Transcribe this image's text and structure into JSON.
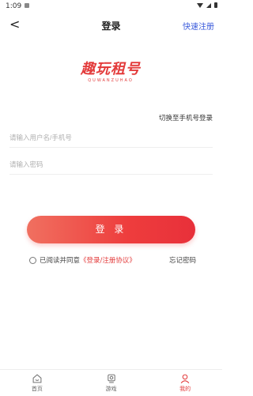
{
  "status": {
    "time": "1:09"
  },
  "header": {
    "back_glyph": "<",
    "title": "登录",
    "quick_register": "快速注册"
  },
  "logo": {
    "main": "趣玩租号",
    "sub": "QUWANZUHAO"
  },
  "switch_label": "切换至手机号登录",
  "form": {
    "username_placeholder": "请输入用户名/手机号",
    "password_placeholder": "请输入密码"
  },
  "login_button": "登 录",
  "agreement": {
    "prefix": "已阅读并同意",
    "link": "《登录/注册协议》",
    "checked": false
  },
  "forgot_password": "忘记密码",
  "nav": {
    "items": [
      {
        "label": "首页",
        "icon": "home-icon",
        "active": false
      },
      {
        "label": "游戏",
        "icon": "game-icon",
        "active": false
      },
      {
        "label": "我的",
        "icon": "user-icon",
        "active": true
      }
    ]
  },
  "colors": {
    "accent": "#e33b3b",
    "link_blue": "#3b5bdb"
  }
}
